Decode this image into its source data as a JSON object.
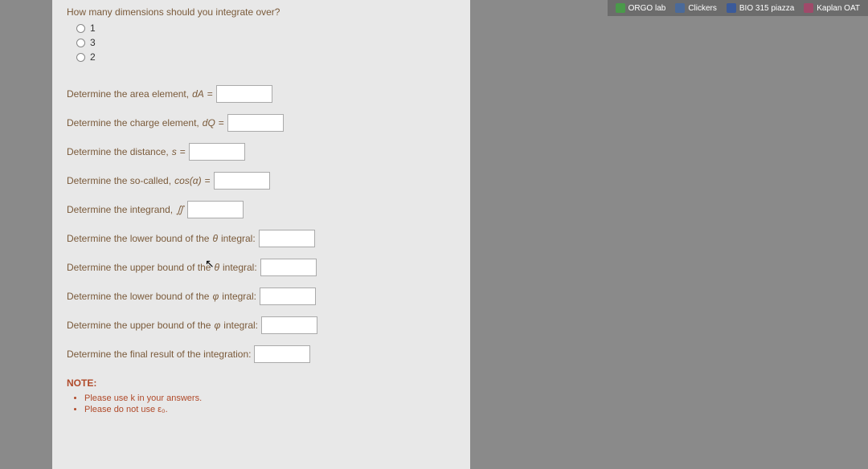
{
  "bookmarks": {
    "items": [
      {
        "label": "ORGO lab",
        "icon_color": "#4a9a4a"
      },
      {
        "label": "Clickers",
        "icon_color": "#4a6a9a"
      },
      {
        "label": "BIO 315 piazza",
        "icon_color": "#3a5a9a"
      },
      {
        "label": "Kaplan OAT",
        "icon_color": "#a04a6a"
      }
    ]
  },
  "question": {
    "prompt": "How many dimensions should you integrate over?",
    "options": [
      "1",
      "3",
      "2"
    ]
  },
  "inline_questions": [
    {
      "pre": "Determine the area element, ",
      "symbol": "dA",
      "post": " ="
    },
    {
      "pre": "Determine the charge element, ",
      "symbol": "dQ",
      "post": " ="
    },
    {
      "pre": "Determine the distance, ",
      "symbol": "s",
      "post": " ="
    },
    {
      "pre": "Determine the so-called, ",
      "symbol": "cos(α)",
      "post": " ="
    },
    {
      "pre": "Determine the integrand, ",
      "symbol": "∬",
      "post": ""
    },
    {
      "pre": "Determine the lower bound of the ",
      "symbol": "θ",
      "post": " integral:"
    },
    {
      "pre": "Determine the upper bound of the ",
      "symbol": "θ",
      "post": " integral:"
    },
    {
      "pre": "Determine the lower bound of the ",
      "symbol": "φ",
      "post": " integral:"
    },
    {
      "pre": "Determine the upper bound of the ",
      "symbol": "φ",
      "post": " integral:"
    },
    {
      "pre": "Determine the final result of the integration:",
      "symbol": "",
      "post": ""
    }
  ],
  "note": {
    "heading": "NOTE:",
    "items": [
      "Please use k in your answers.",
      "Please do not use ε₀."
    ]
  }
}
